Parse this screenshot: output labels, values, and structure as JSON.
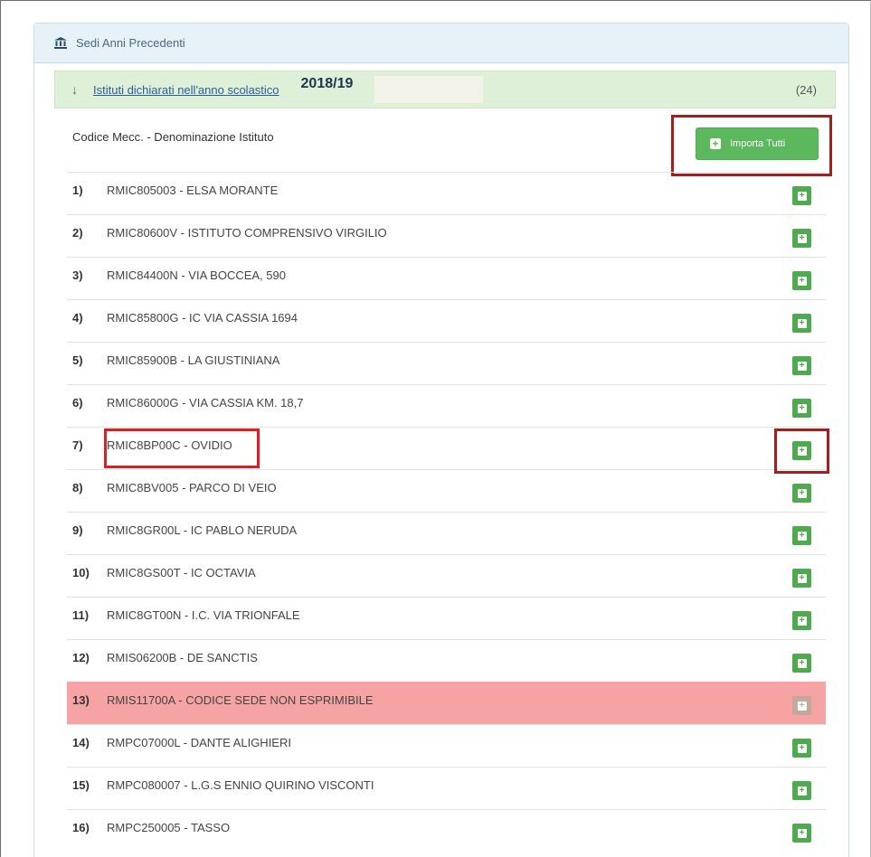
{
  "panel": {
    "title": "Sedi Anni Precedenti",
    "icon": "bank-icon"
  },
  "subheader": {
    "link_text": "Istituti dichiarati nell'anno scolastico",
    "year": "2018/19",
    "count": "(24)",
    "icon": "arrow-down-icon"
  },
  "table": {
    "column_header": "Codice Mecc. - Denominazione Istituto",
    "import_all_label": "Importa Tutti",
    "rows": [
      {
        "index": "1)",
        "name": "RMIC805003 - ELSA MORANTE",
        "status": "normal"
      },
      {
        "index": "2)",
        "name": "RMIC80600V - ISTITUTO COMPRENSIVO VIRGILIO",
        "status": "normal"
      },
      {
        "index": "3)",
        "name": "RMIC84400N - VIA BOCCEA, 590",
        "status": "normal"
      },
      {
        "index": "4)",
        "name": "RMIC85800G - IC VIA CASSIA 1694",
        "status": "normal"
      },
      {
        "index": "5)",
        "name": "RMIC85900B - LA GIUSTINIANA",
        "status": "normal"
      },
      {
        "index": "6)",
        "name": "RMIC86000G - VIA CASSIA KM. 18,7",
        "status": "normal"
      },
      {
        "index": "7)",
        "name": "RMIC8BP00C - OVIDIO",
        "status": "normal"
      },
      {
        "index": "8)",
        "name": "RMIC8BV005 - PARCO DI VEIO",
        "status": "normal"
      },
      {
        "index": "9)",
        "name": "RMIC8GR00L - IC PABLO NERUDA",
        "status": "normal"
      },
      {
        "index": "10)",
        "name": "RMIC8GS00T - IC OCTAVIA",
        "status": "normal"
      },
      {
        "index": "11)",
        "name": "RMIC8GT00N - I.C. VIA TRIONFALE",
        "status": "normal"
      },
      {
        "index": "12)",
        "name": "RMIS06200B - DE SANCTIS",
        "status": "normal"
      },
      {
        "index": "13)",
        "name": "RMIS11700A - CODICE SEDE NON ESPRIMIBILE",
        "status": "error"
      },
      {
        "index": "14)",
        "name": "RMPC07000L - DANTE ALIGHIERI",
        "status": "normal"
      },
      {
        "index": "15)",
        "name": "RMPC080007 - L.G.S ENNIO QUIRINO VISCONTI",
        "status": "normal"
      },
      {
        "index": "16)",
        "name": "RMPC250005 - TASSO",
        "status": "normal"
      }
    ]
  },
  "colors": {
    "success": "#5cb85c",
    "error_row": "#f5a3a3",
    "highlight": "#a02020",
    "header_bg": "#e6f1f8",
    "subheader_bg": "#def0d8"
  }
}
